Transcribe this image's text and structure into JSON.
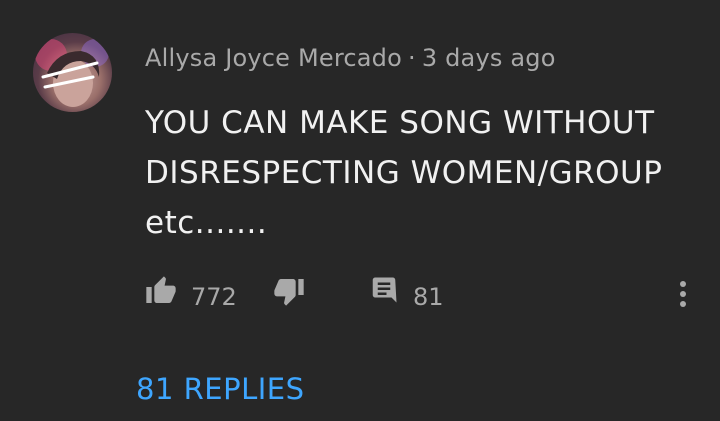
{
  "comment": {
    "author": "Allysa Joyce Mercado",
    "separator": "·",
    "timestamp": "3 days ago",
    "text_lines": [
      "YOU CAN MAKE SONG WITHOUT",
      "DISRESPECTING WOMEN/GROUP",
      "etc......."
    ],
    "likes": "772",
    "replies_count": "81",
    "replies_label": "81 REPLIES"
  },
  "icons": {
    "like": "thumbs-up-icon",
    "dislike": "thumbs-down-icon",
    "reply": "comment-icon",
    "more": "more-vertical-icon"
  },
  "colors": {
    "background": "#272727",
    "text": "#f1f1f1",
    "secondary": "#a9a9a9",
    "link": "#3ea6ff"
  }
}
